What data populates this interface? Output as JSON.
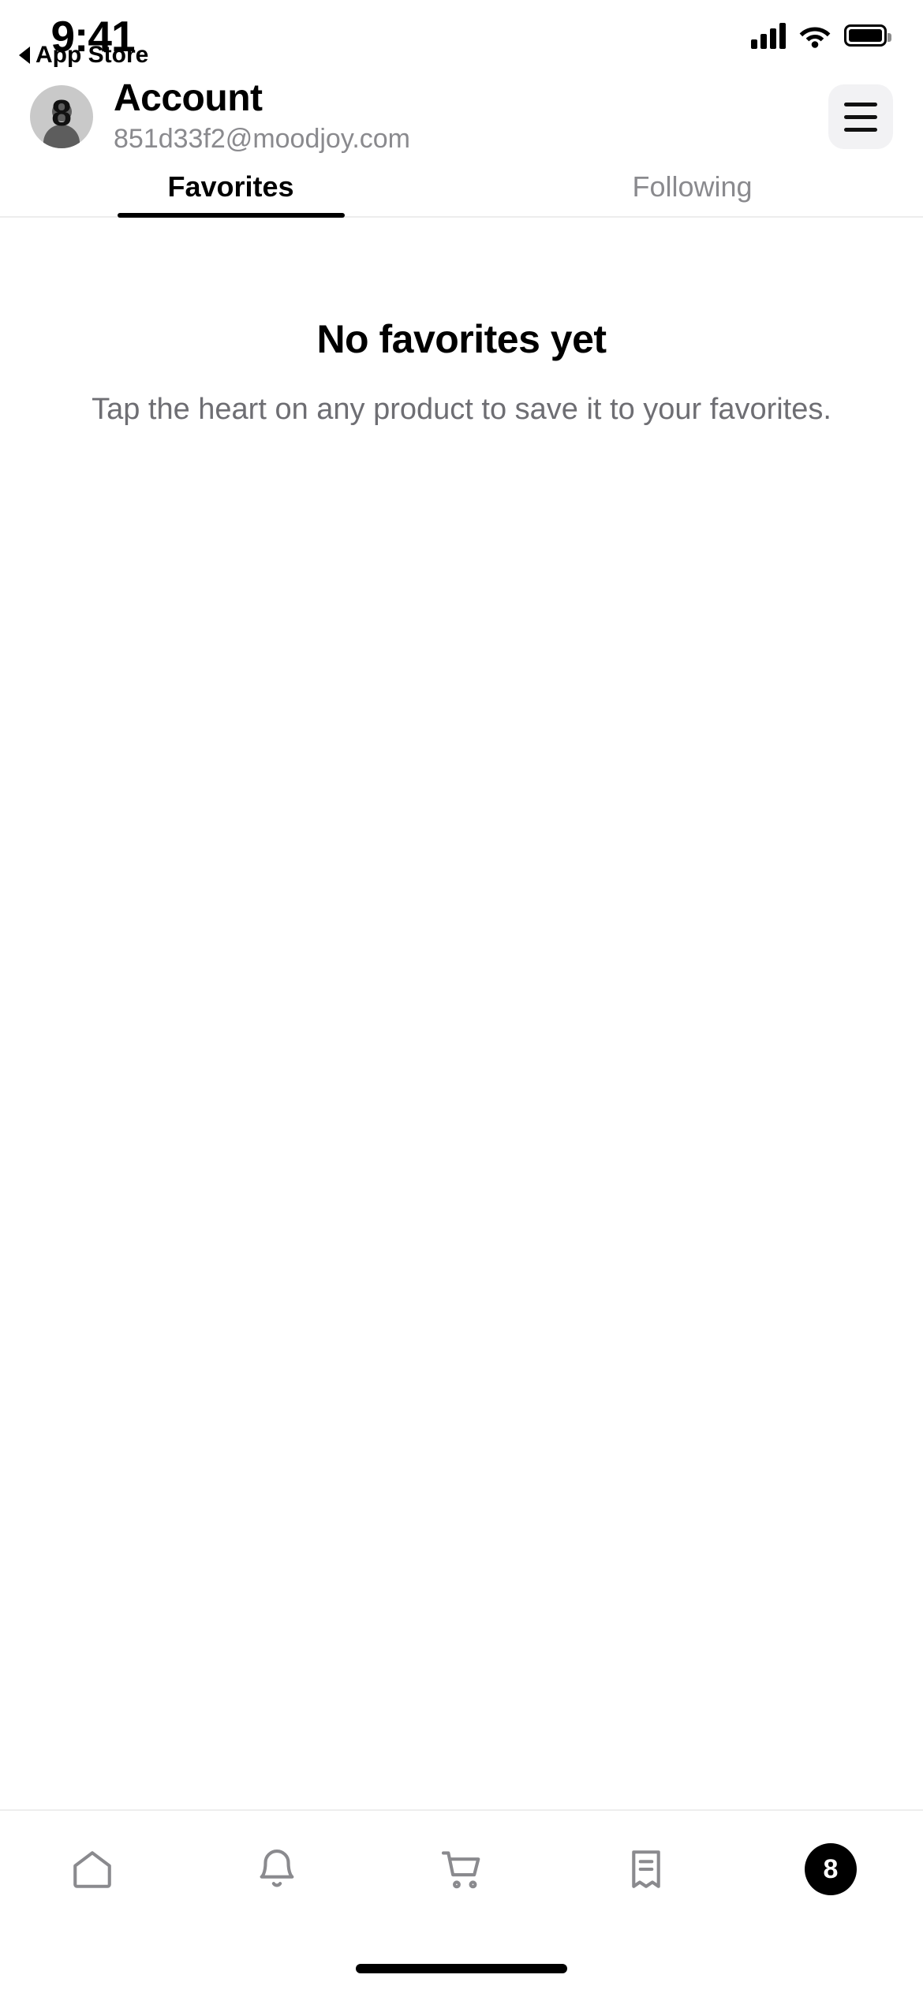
{
  "status_bar": {
    "time": "9:41",
    "back_label": "App Store",
    "icons": {
      "cellular": "signal-bars-icon",
      "wifi": "wifi-icon",
      "battery": "battery-full-icon"
    }
  },
  "header": {
    "title": "Account",
    "email": "851d33f2@moodjoy.com",
    "avatar_initial": "8",
    "menu_label": "hamburger-menu-icon"
  },
  "tabs": [
    {
      "label": "Favorites",
      "active": true
    },
    {
      "label": "Following",
      "active": false
    }
  ],
  "empty_state": {
    "title": "No favorites yet",
    "subtitle": "Tap the heart on any product to save it to your favorites."
  },
  "tab_bar": [
    {
      "name": "home",
      "icon": "home-icon",
      "badge": null
    },
    {
      "name": "notifications",
      "icon": "bell-icon",
      "badge": null
    },
    {
      "name": "cart",
      "icon": "shopping-cart-icon",
      "badge": null
    },
    {
      "name": "orders",
      "icon": "receipt-icon",
      "badge": null
    },
    {
      "name": "account",
      "icon": "account-avatar-icon",
      "badge": "8"
    }
  ],
  "colors": {
    "text_primary": "#000000",
    "text_secondary": "#8a8a8e",
    "text_body": "#6e6e73",
    "avatar_bg": "#c9c9c9",
    "menu_bg": "#f2f2f4",
    "divider": "#ededed",
    "tab_icon": "#8a8a8e",
    "badge_bg": "#000000"
  }
}
